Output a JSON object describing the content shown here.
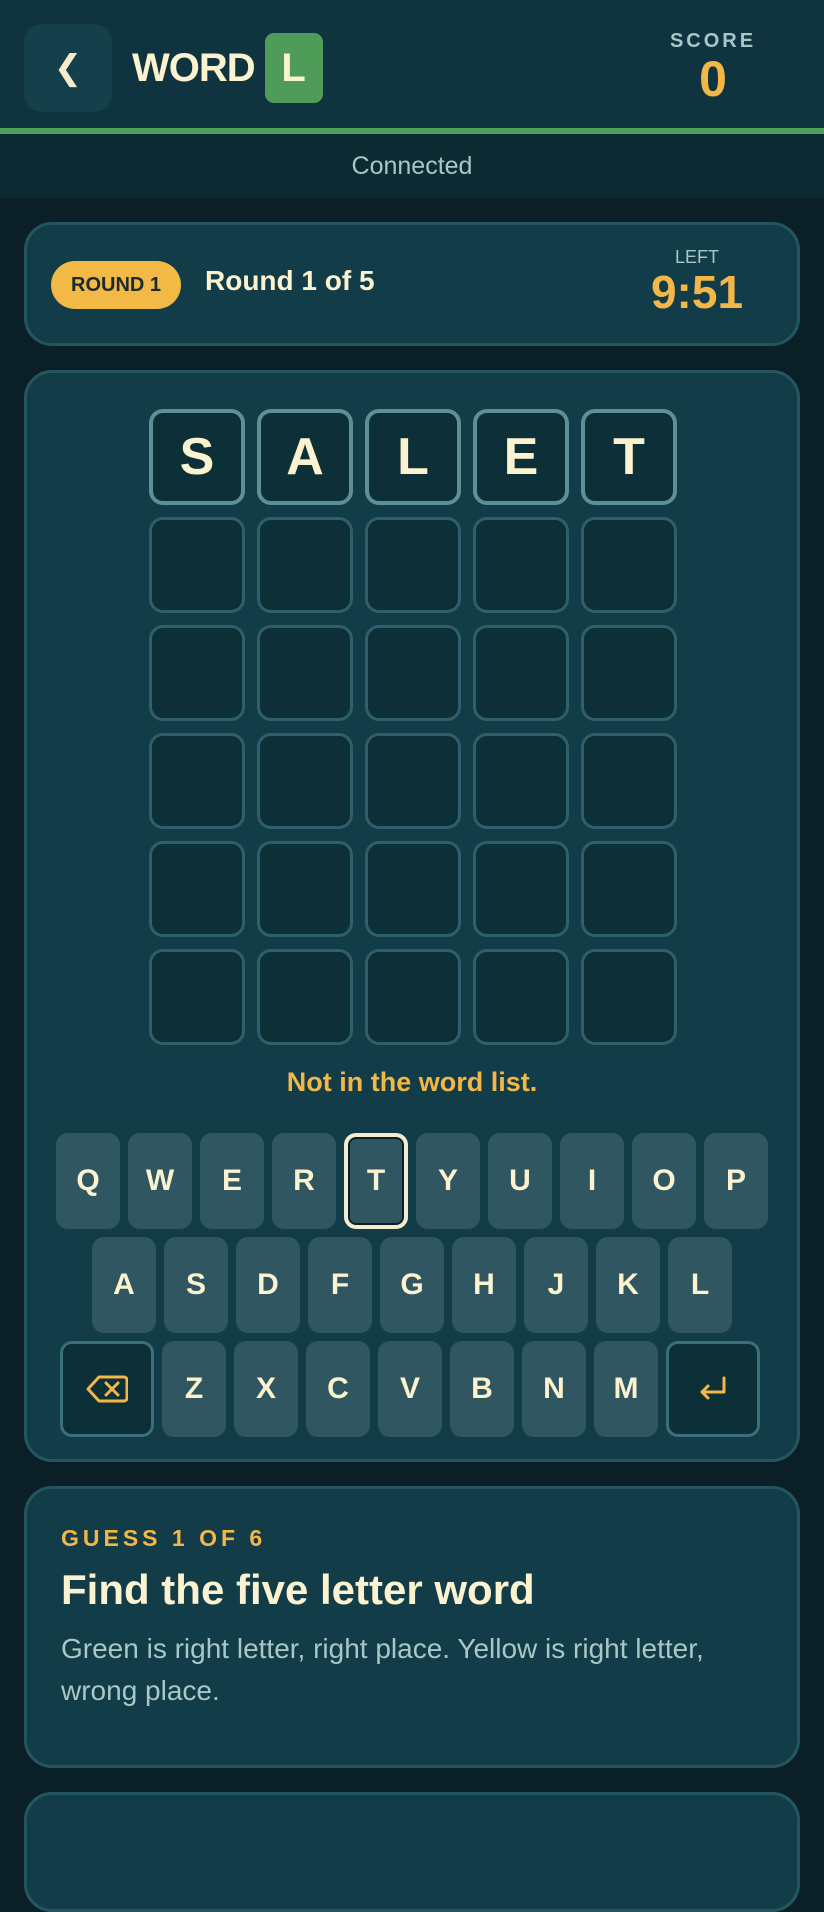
{
  "header": {
    "back_icon": "chevron-left-icon",
    "back_glyph": "❮",
    "logo_word": "WORD",
    "logo_letter": "L",
    "score_label": "SCORE",
    "score_value": "0"
  },
  "status": "Connected",
  "round": {
    "badge": "ROUND 1",
    "text": "Round 1 of 5",
    "time_label": "LEFT",
    "time_value": "9:51"
  },
  "board": {
    "rows": [
      [
        "S",
        "A",
        "L",
        "E",
        "T"
      ],
      [
        "",
        "",
        "",
        "",
        ""
      ],
      [
        "",
        "",
        "",
        "",
        ""
      ],
      [
        "",
        "",
        "",
        "",
        ""
      ],
      [
        "",
        "",
        "",
        "",
        ""
      ],
      [
        "",
        "",
        "",
        "",
        ""
      ]
    ],
    "message": "Not in the word list."
  },
  "keyboard": {
    "row1": [
      "Q",
      "W",
      "E",
      "R",
      "T",
      "Y",
      "U",
      "I",
      "O",
      "P"
    ],
    "row2": [
      "A",
      "S",
      "D",
      "F",
      "G",
      "H",
      "J",
      "K",
      "L"
    ],
    "row3": [
      "Z",
      "X",
      "C",
      "V",
      "B",
      "N",
      "M"
    ],
    "backspace_icon": "backspace-icon",
    "enter_icon": "enter-icon",
    "active_key": "T"
  },
  "info": {
    "eyebrow": "GUESS 1 OF 6",
    "title": "Find the five letter word",
    "body": "Green is right letter, right place. Yellow is right letter, wrong place."
  },
  "colors": {
    "accent_green": "#4e9c58",
    "accent_yellow": "#f3b747",
    "background": "#0a1f26",
    "card": "#123c47"
  }
}
